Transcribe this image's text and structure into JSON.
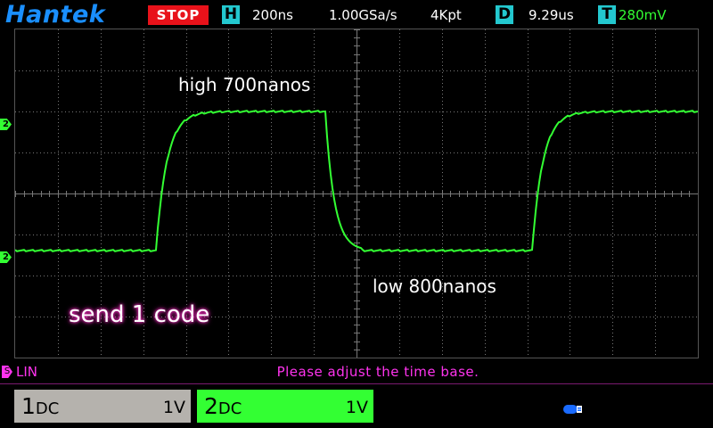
{
  "header": {
    "logo": "Hantek",
    "run_state": "STOP",
    "horizontal_badge": "H",
    "timebase": "200ns",
    "sample_rate": "1.00GSa/s",
    "memory_depth": "4Kpt",
    "delay_badge": "D",
    "delay": "9.29us",
    "trigger_badge": "T",
    "trigger_level": "280mV"
  },
  "screen": {
    "annotations": {
      "high": "high 700nanos",
      "low": "low 800nanos",
      "send": "send 1 code"
    },
    "channel_marker_label": "2",
    "trace_color": "#33ff33",
    "grid_color": "#777777"
  },
  "status": {
    "mode": "LIN",
    "message": "Please adjust the time base."
  },
  "channels": [
    {
      "number": "1",
      "coupling": "DC",
      "scale": "1V",
      "color": "#b5b2ad"
    },
    {
      "number": "2",
      "coupling": "DC",
      "scale": "1V",
      "color": "#33ff33"
    }
  ],
  "icons": {
    "usb": "usb-icon"
  }
}
